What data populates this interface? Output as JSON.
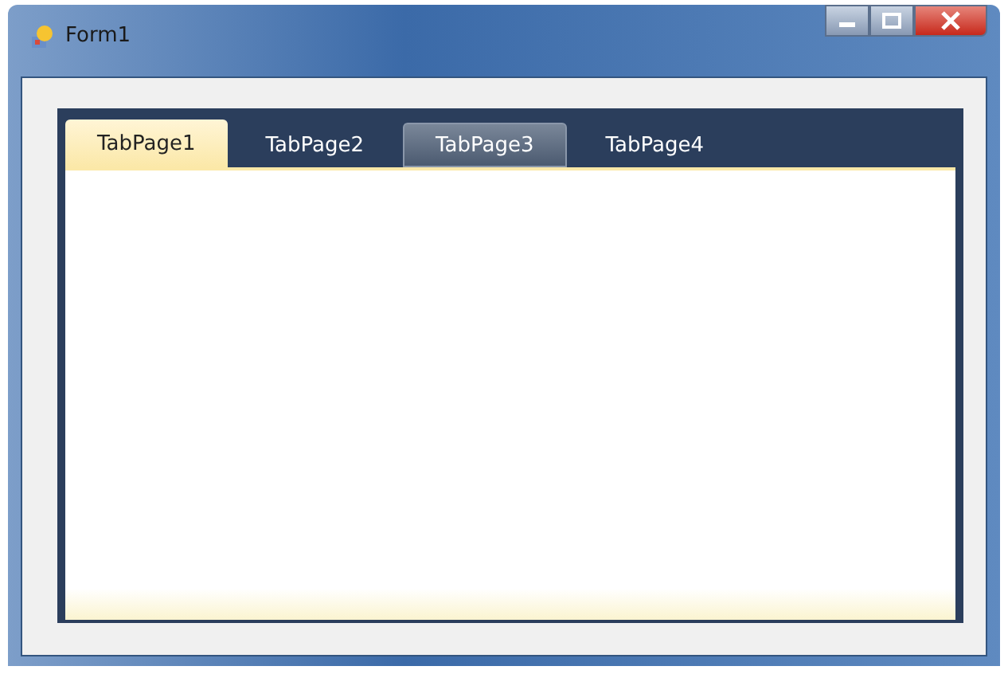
{
  "window": {
    "title": "Form1"
  },
  "tabs": [
    {
      "label": "TabPage1",
      "selected": true,
      "hovered": false
    },
    {
      "label": "TabPage2",
      "selected": false,
      "hovered": false
    },
    {
      "label": "TabPage3",
      "selected": false,
      "hovered": true
    },
    {
      "label": "TabPage4",
      "selected": false,
      "hovered": false
    }
  ]
}
